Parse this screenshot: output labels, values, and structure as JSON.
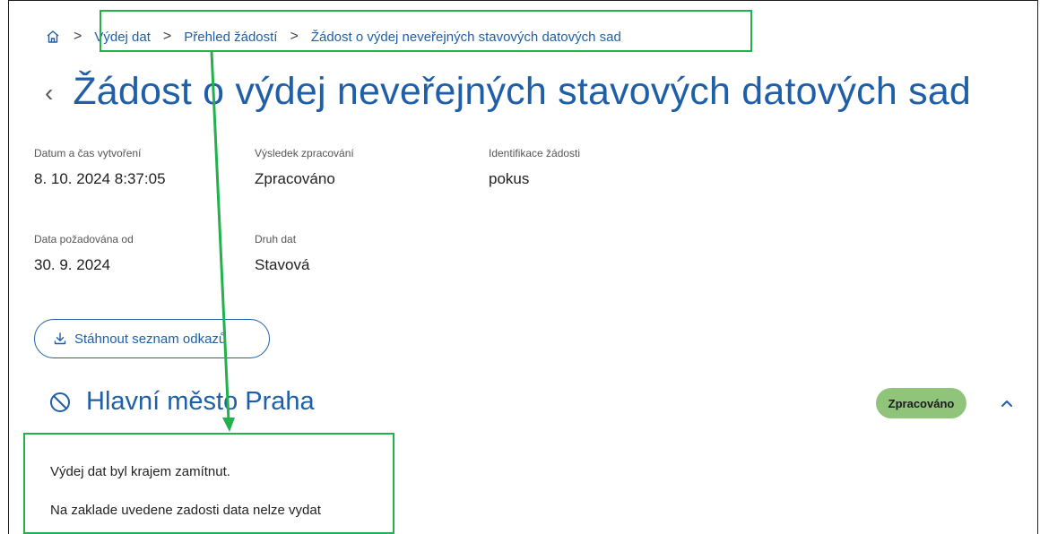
{
  "breadcrumb": {
    "items": [
      "Výdej dat",
      "Přehled žádostí",
      "Žádost o výdej neveřejných stavových datových sad"
    ]
  },
  "page": {
    "title": "Žádost o výdej neveřejných stavových datových sad"
  },
  "details": {
    "created_label": "Datum a čas vytvoření",
    "created_value": "8. 10. 2024 8:37:05",
    "result_label": "Výsledek zpracování",
    "result_value": "Zpracováno",
    "id_label": "Identifikace žádosti",
    "id_value": "pokus",
    "from_label": "Data požadována od",
    "from_value": "30. 9. 2024",
    "type_label": "Druh dat",
    "type_value": "Stavová"
  },
  "actions": {
    "download_label": "Stáhnout seznam odkazů"
  },
  "region": {
    "name": "Hlavní město Praha",
    "status": "Zpracováno",
    "status_color": "#8fc47a",
    "messages": [
      "Výdej dat byl krajem zamítnut.",
      "Na zaklade uvedene zadosti data nelze vydat"
    ]
  },
  "colors": {
    "accent": "#1f5fa8",
    "highlight": "#22b14c"
  }
}
